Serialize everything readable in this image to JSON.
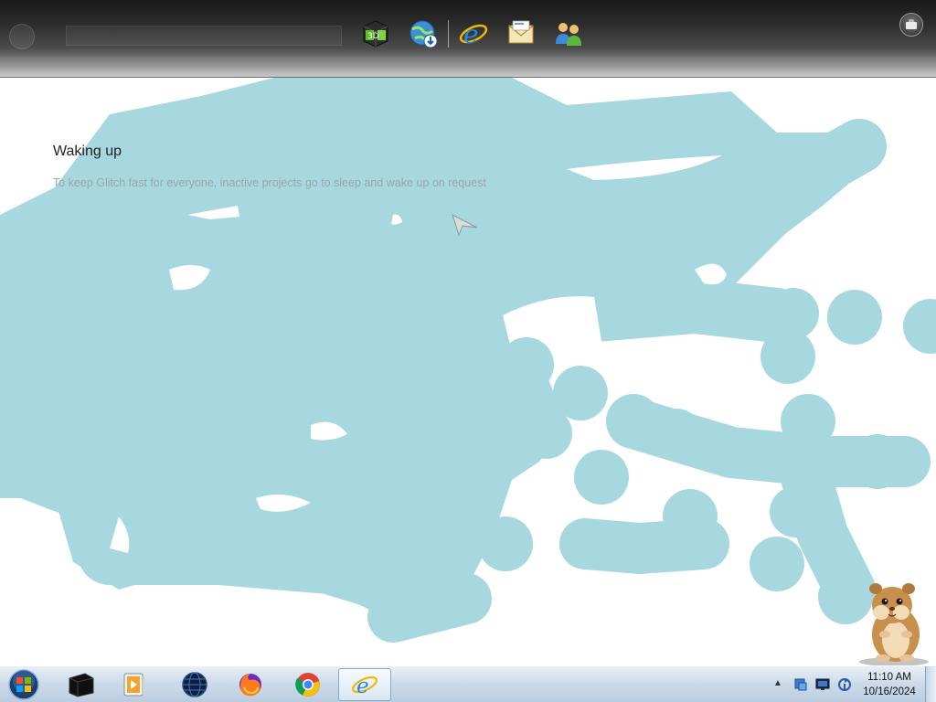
{
  "dock": {
    "items": [
      {
        "name": "nvidia-3d-icon",
        "label": "3D"
      },
      {
        "name": "globe-download-icon",
        "label": ""
      },
      {
        "name": "internet-explorer-icon",
        "label": "e"
      },
      {
        "name": "mail-envelope-icon",
        "label": ""
      },
      {
        "name": "people-network-icon",
        "label": ""
      }
    ]
  },
  "page": {
    "title": "Waking up",
    "message": "To keep Glitch fast for everyone, inactive projects go to sleep and wake up on request"
  },
  "colors": {
    "paint": "#a8d8df",
    "taskbar": "#c4d6e8",
    "title_text": "#1f1f1f",
    "message_text": "#9aa6a9"
  },
  "taskbar": {
    "apps": [
      {
        "name": "start-orb-icon"
      },
      {
        "name": "terminal-box-icon"
      },
      {
        "name": "media-player-icon"
      },
      {
        "name": "globe-dark-icon"
      },
      {
        "name": "firefox-icon"
      },
      {
        "name": "chrome-icon"
      },
      {
        "name": "internet-explorer-icon",
        "active": true
      }
    ],
    "tray": {
      "icons": [
        "network-shield-icon",
        "monitor-icon",
        "sync-icon"
      ]
    },
    "clock": {
      "time": "11:10 AM",
      "date": "10/16/2024"
    }
  }
}
